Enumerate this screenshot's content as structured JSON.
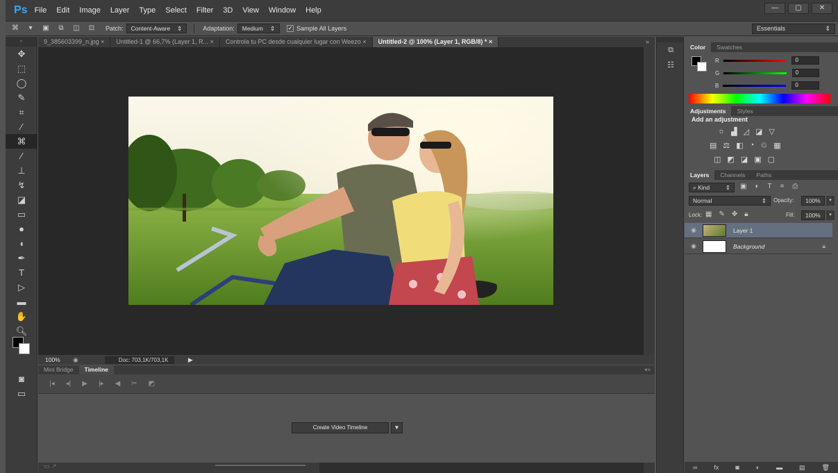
{
  "app": {
    "logo": "Ps"
  },
  "menu": [
    "File",
    "Edit",
    "Image",
    "Layer",
    "Type",
    "Select",
    "Filter",
    "3D",
    "View",
    "Window",
    "Help"
  ],
  "window_controls": [
    "—",
    "▢",
    "✕"
  ],
  "options_bar": {
    "patch_label": "Patch:",
    "patch_value": "Content-Aware",
    "adaptation_label": "Adaptation:",
    "adaptation_value": "Medium",
    "sample_all_label": "Sample All Layers",
    "sample_all_checked": true,
    "workspace": "Essentials"
  },
  "doc_tabs": [
    {
      "label": "9_385603399_n.jpg",
      "active": false
    },
    {
      "label": "Untitled-1 @ 66,7% (Layer 1, R...",
      "active": false
    },
    {
      "label": "Controla tu PC desde cualquier lugar con Weezo",
      "active": false
    },
    {
      "label": "Untitled-2 @ 100% (Layer 1, RGB/8) *",
      "active": true
    }
  ],
  "status": {
    "zoom": "100%",
    "doc_info": "Doc: 703,1K/703,1K"
  },
  "timeline": {
    "tabs": [
      "Mini Bridge",
      "Timeline"
    ],
    "active_tab": "Timeline",
    "create_button": "Create Video Timeline"
  },
  "color_panel": {
    "tabs": [
      "Color",
      "Swatches"
    ],
    "r": {
      "label": "R",
      "value": "0"
    },
    "g": {
      "label": "G",
      "value": "0"
    },
    "b": {
      "label": "B",
      "value": "0"
    }
  },
  "adjustments_panel": {
    "tabs": [
      "Adjustments",
      "Styles"
    ],
    "title": "Add an adjustment"
  },
  "layers_panel": {
    "tabs": [
      "Layers",
      "Channels",
      "Paths"
    ],
    "filter": "Kind",
    "blend_mode": "Normal",
    "opacity_label": "Opacity:",
    "opacity": "100%",
    "lock_label": "Lock:",
    "fill_label": "Fill:",
    "fill": "100%",
    "layers": [
      {
        "name": "Layer 1",
        "selected": true
      },
      {
        "name": "Background",
        "selected": false
      }
    ]
  },
  "colors": {
    "accent": "#31a8ff",
    "foreground": "#000000",
    "background": "#ffffff"
  }
}
